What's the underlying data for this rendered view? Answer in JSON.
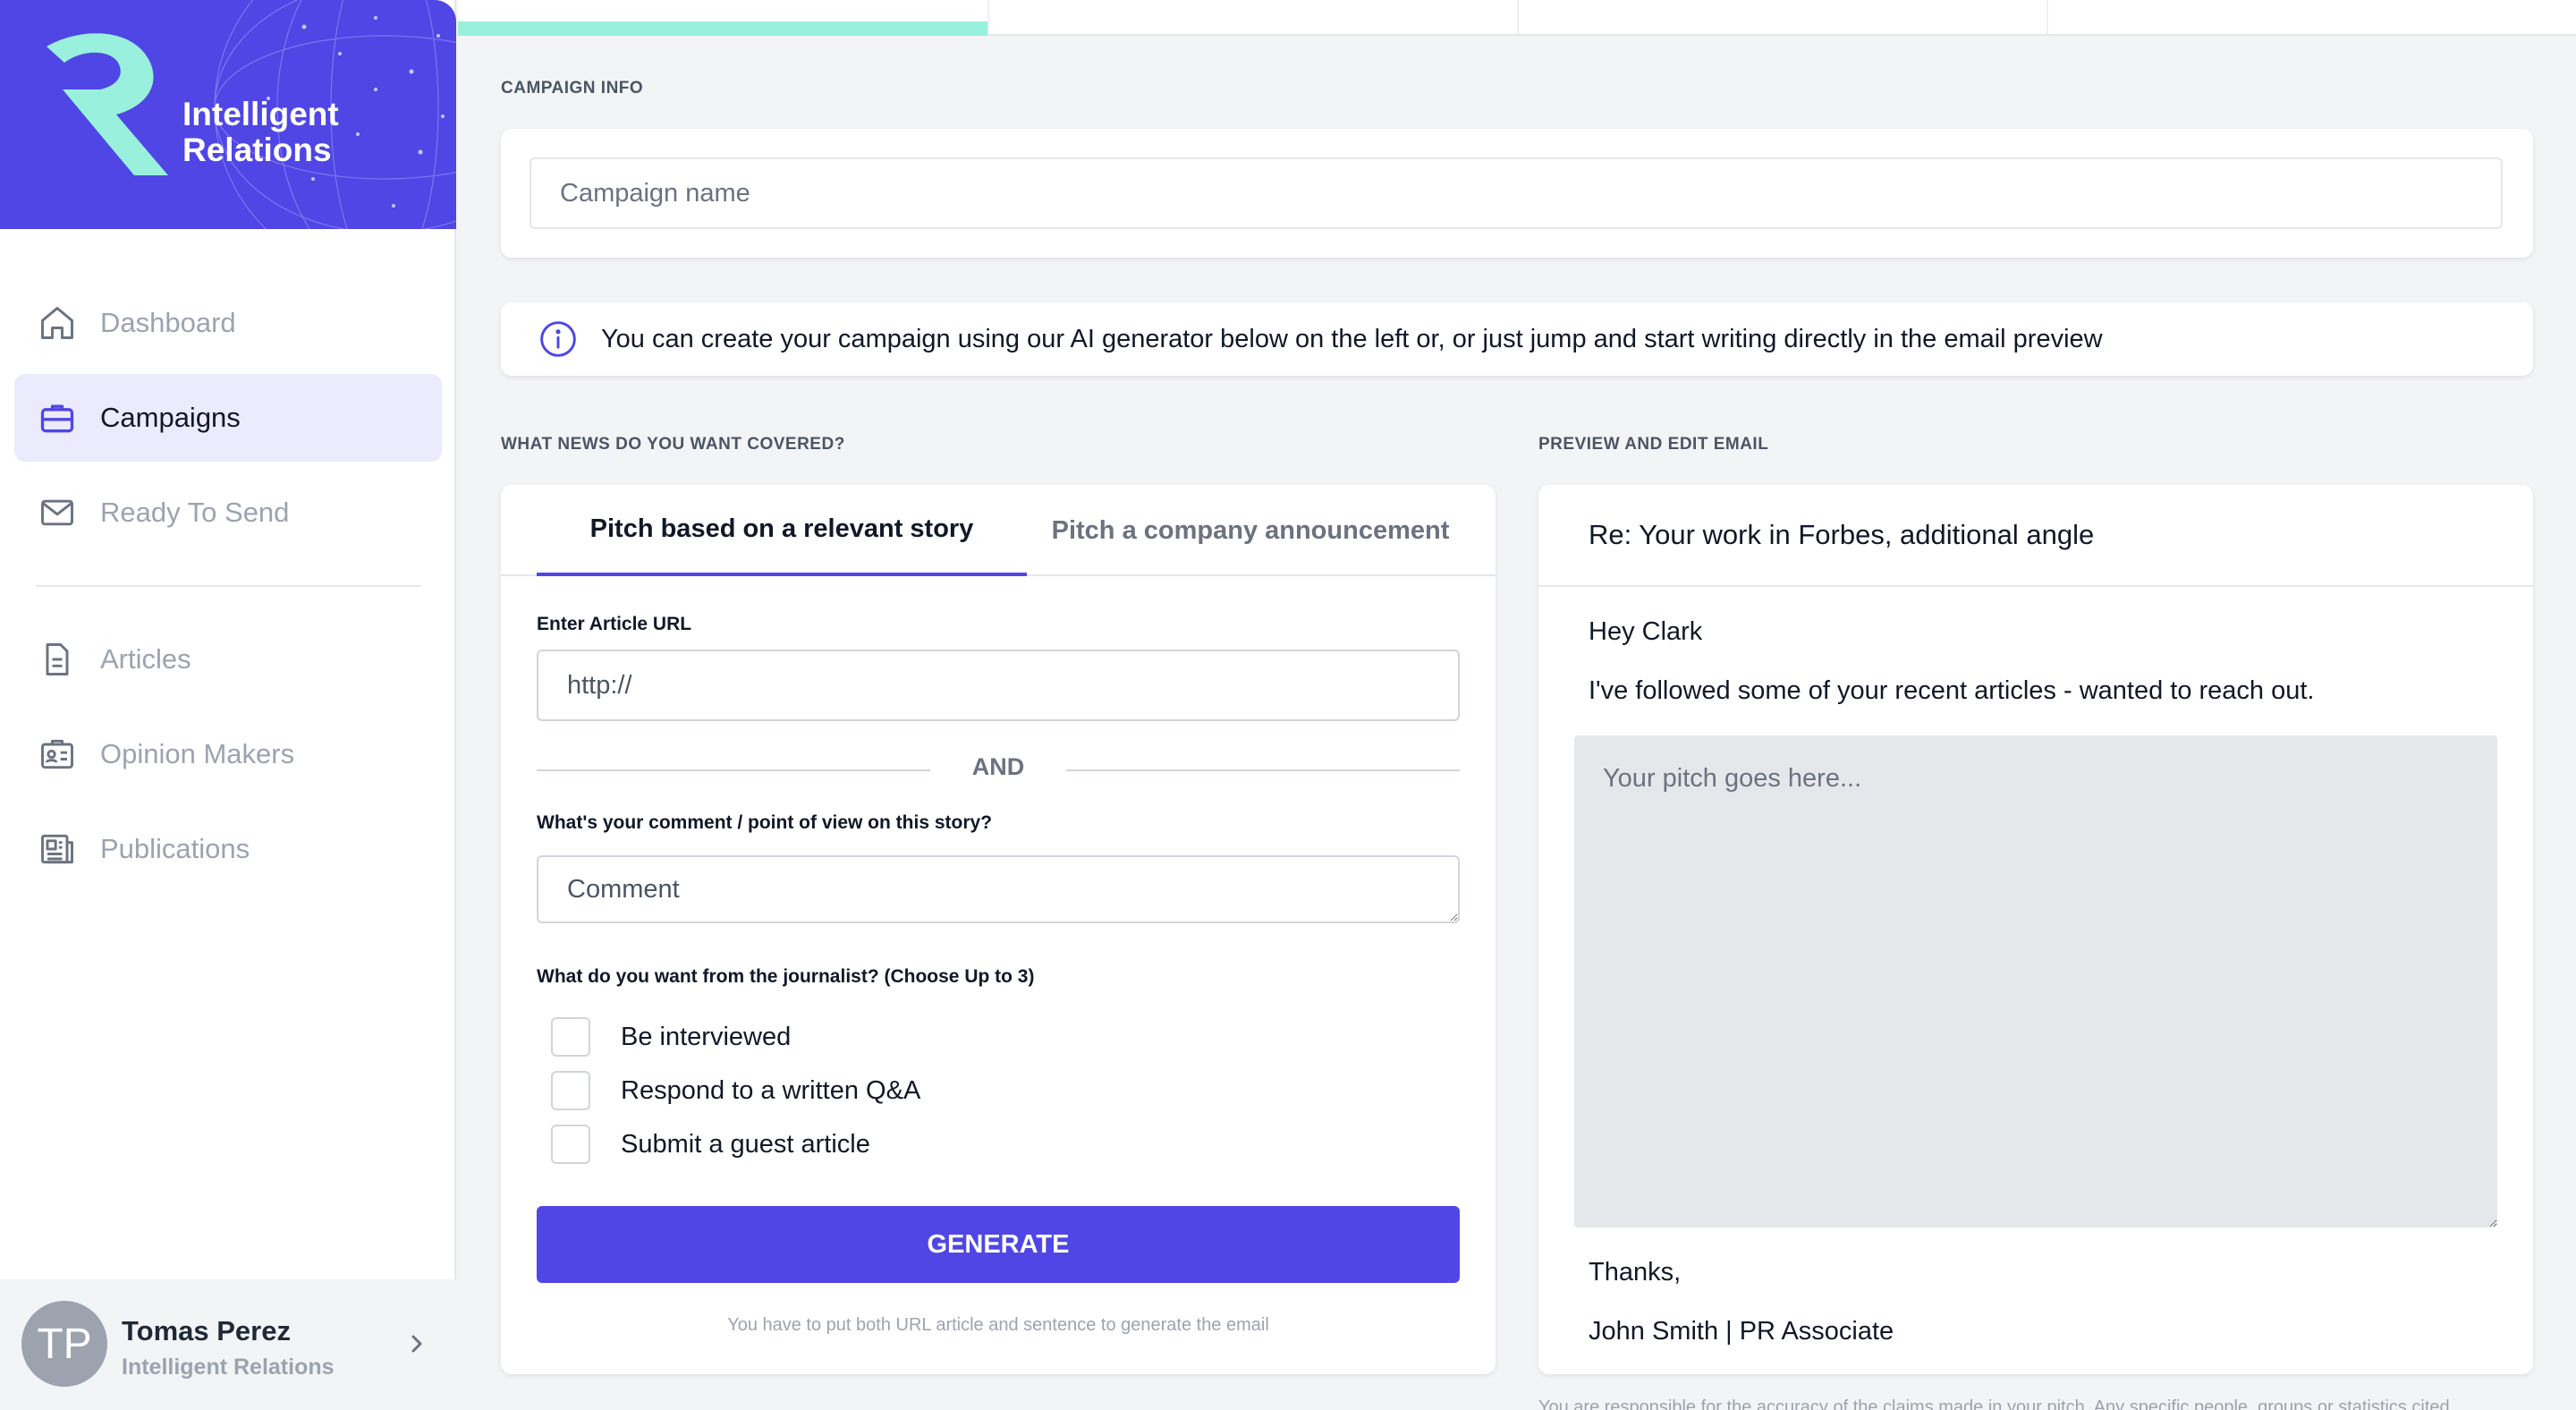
{
  "brand": {
    "name_line1": "Intelligent",
    "name_line2": "Relations",
    "primary": "#4f46e5",
    "accent": "#99f0dc"
  },
  "sidebar": {
    "items": [
      {
        "label": "Dashboard",
        "icon": "home-icon",
        "active": false
      },
      {
        "label": "Campaigns",
        "icon": "briefcase-icon",
        "active": true
      },
      {
        "label": "Ready To Send",
        "icon": "mail-icon",
        "active": false
      },
      {
        "label": "Articles",
        "icon": "document-icon",
        "active": false
      },
      {
        "label": "Opinion Makers",
        "icon": "id-card-icon",
        "active": false
      },
      {
        "label": "Publications",
        "icon": "newspaper-icon",
        "active": false
      }
    ]
  },
  "user": {
    "initials": "TP",
    "name": "Tomas Perez",
    "org": "Intelligent Relations"
  },
  "progress": {
    "steps_total": 4,
    "current_step": 1
  },
  "campaign": {
    "section_label": "CAMPAIGN INFO",
    "name_placeholder": "Campaign name"
  },
  "info": {
    "text": "You can create your campaign using our AI generator below on the left or, or just jump and start writing directly in the email preview"
  },
  "generator": {
    "section_label": "WHAT NEWS DO YOU WANT COVERED?",
    "tabs": [
      {
        "label": "Pitch based on a relevant story",
        "active": true
      },
      {
        "label": "Pitch a company announcement",
        "active": false
      }
    ],
    "url_label": "Enter Article URL",
    "url_placeholder": "http://",
    "and_text": "AND",
    "comment_label": "What's your comment / point of view on this story?",
    "comment_placeholder": "Comment",
    "wants_label": "What do you want from the journalist? (Choose Up to 3)",
    "options": [
      {
        "label": "Be interviewed",
        "checked": false
      },
      {
        "label": "Respond to a written Q&A",
        "checked": false
      },
      {
        "label": "Submit a guest article",
        "checked": false
      }
    ],
    "generate_label": "GENERATE",
    "hint": "You have to put both URL article and sentence to generate the email"
  },
  "preview": {
    "section_label": "PREVIEW AND EDIT EMAIL",
    "subject": "Re: Your work in Forbes, additional angle",
    "greeting": "Hey Clark",
    "intro": "I've followed some of your recent articles - wanted to reach out.",
    "pitch_placeholder": "Your pitch goes here...",
    "signoff": "Thanks,",
    "signature": "John Smith | PR Associate",
    "disclaimer": "You are responsible for the accuracy of the claims made in your pitch. Any specific people, groups or statistics cited"
  }
}
